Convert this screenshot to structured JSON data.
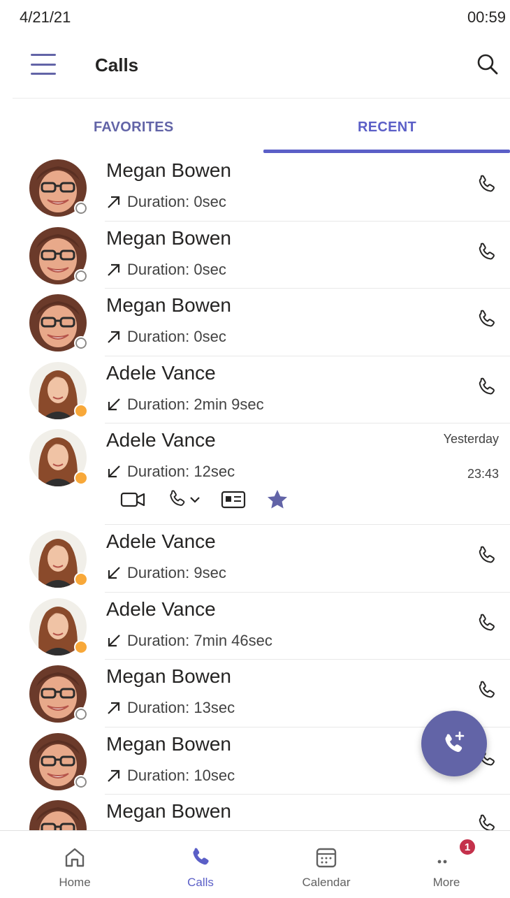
{
  "status_bar": {
    "date": "4/21/21",
    "time": "00:59"
  },
  "header": {
    "title": "Calls",
    "menu_icon": "hamburger-menu-icon",
    "search_icon": "search-icon"
  },
  "tabs": [
    {
      "label": "FAVORITES",
      "active": false
    },
    {
      "label": "RECENT",
      "active": true
    }
  ],
  "calls": [
    {
      "name": "Megan Bowen",
      "direction": "outgoing",
      "duration": "Duration: 0sec",
      "presence": "offline"
    },
    {
      "name": "Megan Bowen",
      "direction": "outgoing",
      "duration": "Duration: 0sec",
      "presence": "offline"
    },
    {
      "name": "Megan Bowen",
      "direction": "outgoing",
      "duration": "Duration: 0sec",
      "presence": "offline"
    },
    {
      "name": "Adele Vance",
      "direction": "incoming",
      "duration": "Duration: 2min 9sec",
      "presence": "away"
    },
    {
      "name": "Adele Vance",
      "direction": "incoming",
      "duration": "Duration: 12sec",
      "presence": "away",
      "date": "Yesterday",
      "time": "23:43",
      "expanded": true
    },
    {
      "name": "Adele Vance",
      "direction": "incoming",
      "duration": "Duration: 9sec",
      "presence": "away"
    },
    {
      "name": "Adele Vance",
      "direction": "incoming",
      "duration": "Duration: 7min 46sec",
      "presence": "away"
    },
    {
      "name": "Megan Bowen",
      "direction": "outgoing",
      "duration": "Duration: 13sec",
      "presence": "offline"
    },
    {
      "name": "Megan Bowen",
      "direction": "outgoing",
      "duration": "Duration: 10sec",
      "presence": "offline"
    },
    {
      "name": "Megan Bowen",
      "direction": "outgoing",
      "duration": "",
      "presence": "offline"
    }
  ],
  "nav": [
    {
      "label": "Home",
      "icon": "home-icon",
      "active": false
    },
    {
      "label": "Calls",
      "icon": "phone-icon",
      "active": true
    },
    {
      "label": "Calendar",
      "icon": "calendar-icon",
      "active": false
    },
    {
      "label": "More",
      "icon": "more-icon",
      "active": false,
      "badge": "1"
    }
  ],
  "colors": {
    "accent": "#6264a7",
    "accent_tab": "#5b5fc7",
    "away": "#f8a839",
    "badge": "#c4314b"
  }
}
